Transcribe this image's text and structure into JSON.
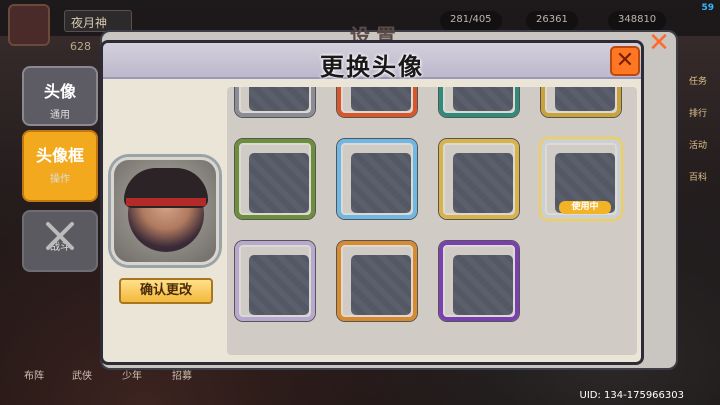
{
  "hud": {
    "fps": "59",
    "player_name": "夜月神",
    "power": "628",
    "resources": [
      "281/405",
      "26361",
      "348810"
    ]
  },
  "settings": {
    "title": "设置",
    "close_icon": "close-icon"
  },
  "left_tabs": [
    {
      "main": "头像",
      "sub": "通用"
    },
    {
      "main": "头像框",
      "sub": "操作"
    },
    {
      "main": "",
      "sub": "战斗"
    }
  ],
  "right_menu": [
    "任务",
    "排行",
    "活动",
    "百科"
  ],
  "bottom_nav": [
    "布阵",
    "武侠",
    "少年",
    "招募"
  ],
  "modal": {
    "title": "更换头像",
    "confirm_label": "确认更改",
    "close_icon": "close-icon"
  },
  "frames": {
    "colors": [
      "#8c8c96",
      "#d9552a",
      "#2f8b7a",
      "#c9a23a",
      "#6b8f3a",
      "#6fb7e4",
      "#d8b34a",
      "#c9d0d6",
      "#b7a8d0",
      "#d88a2e",
      "#7a3fb0"
    ],
    "in_use_index": 7,
    "in_use_label": "使用中"
  },
  "uid": "UID: 134-175966303",
  "accent": {
    "orange": "#ff7722",
    "gold": "#f3b327"
  }
}
